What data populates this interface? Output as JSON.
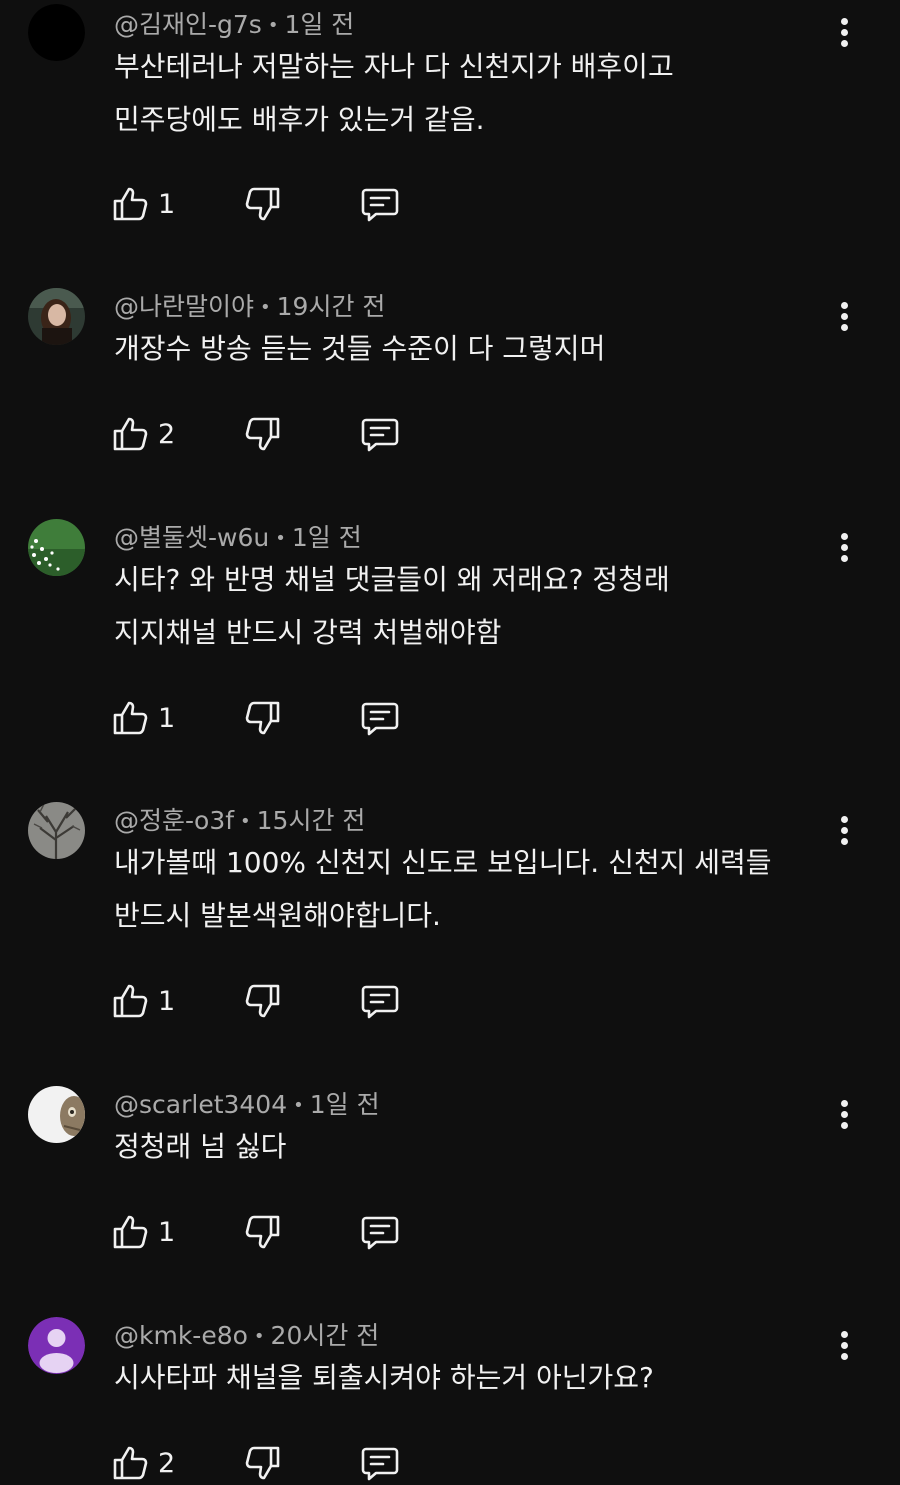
{
  "comments": [
    {
      "handle": "@김재인-g7s",
      "time": "1일 전",
      "lines": [
        "부산테러나 저말하는 자나 다 신천지가 배후이고",
        "민주당에도 배후가 있는거 같음."
      ],
      "likes": "1",
      "avatar": "black-circle"
    },
    {
      "handle": "@나란말이야",
      "time": "19시간 전",
      "lines": [
        "개장수 방송 듣는 것들  수준이 다 그렇지머"
      ],
      "likes": "2",
      "avatar": "portrait-photo"
    },
    {
      "handle": "@별둘셋-w6u",
      "time": "1일 전",
      "lines": [
        "시타? 와 반명 채널 댓글들이 왜 저래요? 정청래",
        "지지채널  반드시 강력 처벌해야함"
      ],
      "likes": "1",
      "avatar": "green-flowers-photo"
    },
    {
      "handle": "@정훈-o3f",
      "time": "15시간 전",
      "lines": [
        "내가볼때 100% 신천지 신도로 보입니다. 신천지 세력들",
        "반드시 발본색원해야합니다."
      ],
      "likes": "1",
      "avatar": "bare-tree-photo"
    },
    {
      "handle": "@scarlet3404",
      "time": "1일 전",
      "lines": [
        "정청래 넘 싫다"
      ],
      "likes": "1",
      "avatar": "cat-photo"
    },
    {
      "handle": "@kmk-e8o",
      "time": "20시간 전",
      "lines": [
        "시사타파 채널을  퇴출시켜야 하는거 아닌가요?"
      ],
      "likes": "2",
      "avatar": "default-purple-person"
    }
  ],
  "separator": "•",
  "colors": {
    "background": "#0f0f0f",
    "text": "#f1f1f1",
    "meta": "#aaaaaa",
    "default_avatar": "#7b2fb5"
  },
  "icons": {
    "like": "thumbs-up-icon",
    "dislike": "thumbs-down-icon",
    "reply": "reply-comment-icon",
    "menu": "more-vertical-icon"
  }
}
